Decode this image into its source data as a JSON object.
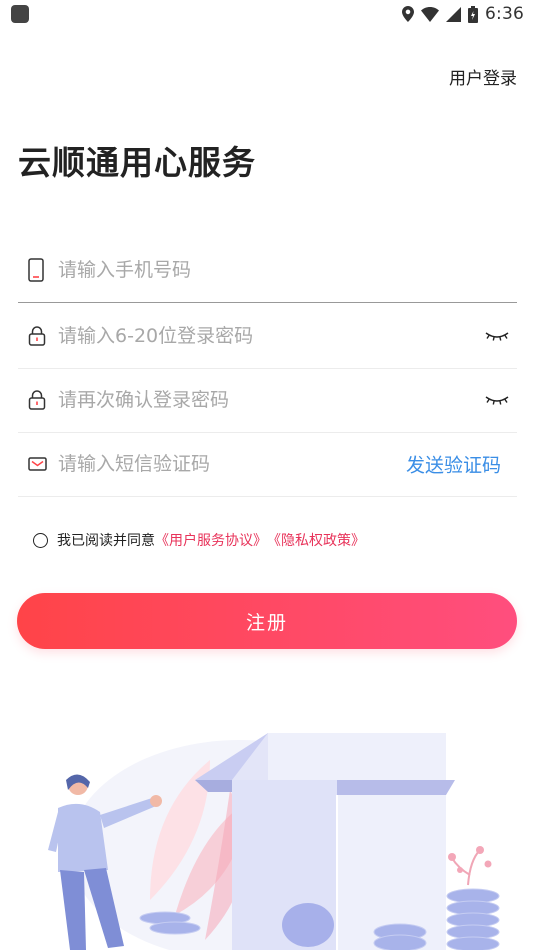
{
  "status_bar": {
    "time": "6:36"
  },
  "header": {
    "login_link": "用户登录"
  },
  "title": "云顺通用心服务",
  "form": {
    "phone": {
      "placeholder": "请输入手机号码",
      "icon": "phone-icon"
    },
    "password": {
      "placeholder": "请输入6-20位登录密码",
      "icon": "lock-icon"
    },
    "confirm_password": {
      "placeholder": "请再次确认登录密码",
      "icon": "lock-icon"
    },
    "sms_code": {
      "placeholder": "请输入短信验证码",
      "icon": "envelope-icon",
      "send_label": "发送验证码"
    }
  },
  "agreement": {
    "prefix": "我已阅读并同意",
    "service_link": "《用户服务协议》",
    "privacy_link": "《隐私权政策》",
    "checked": false
  },
  "register_button": "注册",
  "colors": {
    "accent_start": "#ff4448",
    "accent_end": "#ff4e7e",
    "link_blue": "#3a8ee6",
    "link_red": "#e8335a"
  }
}
